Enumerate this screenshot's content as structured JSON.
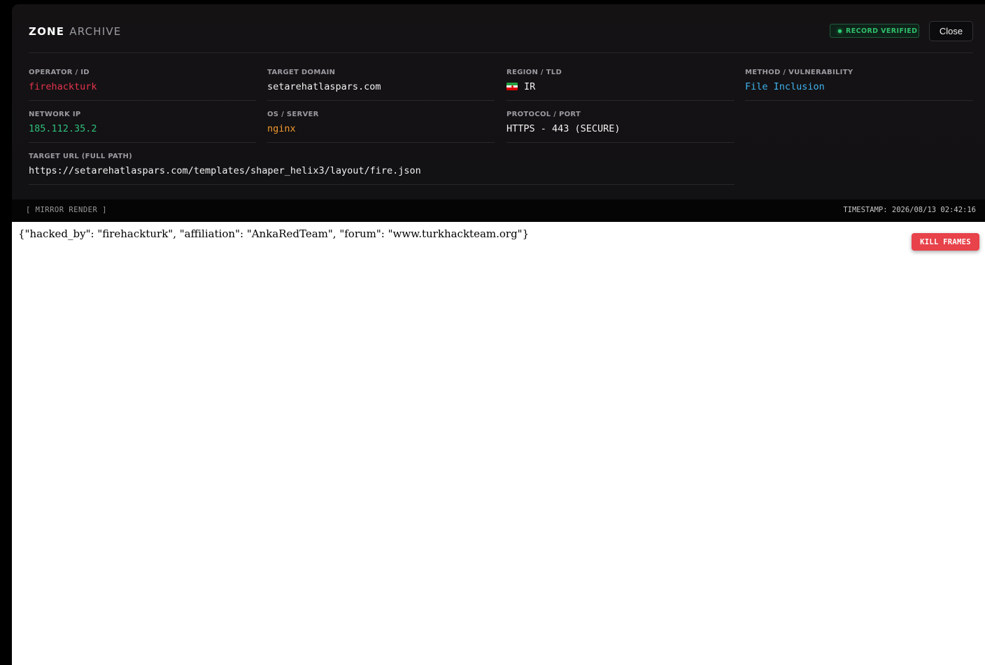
{
  "header": {
    "title_strong": "ZONE",
    "title_soft": "ARCHIVE",
    "badge": "RECORD VERIFIED",
    "close_label": "Close"
  },
  "fields": {
    "operator": {
      "label": "OPERATOR / ID",
      "value": "firehackturk"
    },
    "domain": {
      "label": "TARGET DOMAIN",
      "value": "setarehatlaspars.com"
    },
    "region": {
      "label": "REGION / TLD",
      "value": "IR",
      "flag": "iran-flag-icon"
    },
    "method": {
      "label": "METHOD / VULNERABILITY",
      "value": "File Inclusion"
    },
    "network_ip": {
      "label": "NETWORK IP",
      "value": "185.112.35.2"
    },
    "os_server": {
      "label": "OS / SERVER",
      "value": "nginx"
    },
    "protocol": {
      "label": "PROTOCOL / PORT",
      "value": "HTTPS - 443 (SECURE)"
    },
    "target_url": {
      "label": "TARGET URL (FULL PATH)",
      "value": "https://setarehatlaspars.com/templates/shaper_helix3/layout/fire.json"
    }
  },
  "mirror": {
    "label": "[ MIRROR RENDER ]",
    "timestamp": "TIMESTAMP: 2026/08/13 02:42:16",
    "content": "{\"hacked_by\": \"firehackturk\", \"affiliation\": \"AnkaRedTeam\", \"forum\": \"www.turkhackteam.org\"}",
    "kill_label": "KILL FRAMES"
  },
  "colors": {
    "operator": "#e5334d",
    "network_ip": "#2fbf7e",
    "os_server": "#f29a2e",
    "method": "#3fb2ee",
    "badge": "#2fbf6a",
    "kill": "#e8424a"
  }
}
